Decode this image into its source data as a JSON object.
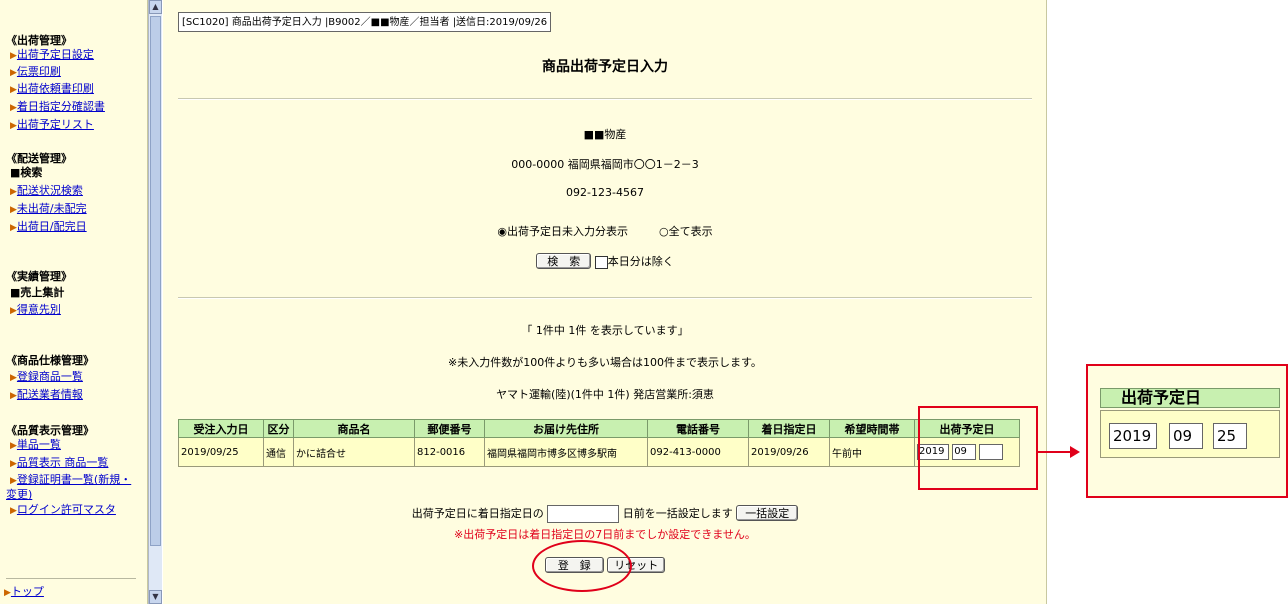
{
  "sidebar": {
    "sections": [
      {
        "title": "《出荷管理》",
        "items": [
          "出荷予定日設定",
          "伝票印刷",
          "出荷依頼書印刷",
          "着日指定分確認書",
          "出荷予定リスト"
        ]
      },
      {
        "title": "《配送管理》",
        "header": "■検索",
        "items": [
          "配送状況検索",
          "未出荷/未配完",
          "出荷日/配完日"
        ]
      },
      {
        "title": "《実績管理》",
        "header": "■売上集計",
        "items": [
          "得意先別"
        ]
      },
      {
        "title": "《商品仕様管理》",
        "items": [
          "登録商品一覧",
          "配送業者情報"
        ]
      },
      {
        "title": "《品質表示管理》",
        "items": [
          "単品一覧",
          "品質表示 商品一覧",
          "登録証明書一覧(新規・変更)",
          "ログイン許可マスタ"
        ]
      }
    ],
    "top_link": "トップ"
  },
  "breadcrumb": "[SC1020] 商品出荷予定日入力 |B9002／■■物産／担当者 |送信日:2019/09/26",
  "page_title": "商品出荷予定日入力",
  "company": {
    "name": "■■物産",
    "address": "000-0000 福岡県福岡市〇〇1－2－3",
    "phone": "092-123-4567"
  },
  "filter": {
    "option_unentered": "出荷予定日未入力分表示",
    "option_all": "全て表示",
    "search_button": "検　索",
    "exclude_today": "本日分は除く"
  },
  "results": {
    "count_text": "「 1件中 1件 を表示しています」",
    "limit_note": "※未入力件数が100件よりも多い場合は100件まで表示します。",
    "carrier_line": "ヤマト運輸(陸)(1件中 1件) 発店営業所:須恵"
  },
  "table": {
    "headers": [
      "受注入力日",
      "区分",
      "商品名",
      "郵便番号",
      "お届け先住所",
      "電話番号",
      "着日指定日",
      "希望時間帯",
      "出荷予定日"
    ],
    "rows": [
      {
        "order_date": "2019/09/25",
        "type": "通信",
        "product": "かに詰合せ",
        "zip": "812-0016",
        "address": "福岡県福岡市博多区博多駅南",
        "phone": "092-413-0000",
        "arrival": "2019/09/26",
        "time": "午前中",
        "ship_year": "2019",
        "ship_month": "09",
        "ship_day": ""
      }
    ]
  },
  "bulk": {
    "prefix": "出荷予定日に着日指定日の",
    "suffix": "日前を一括設定します",
    "button": "一括設定",
    "warning": "※出荷予定日は着日指定日の7日前までしか設定できません。"
  },
  "actions": {
    "register": "登　録",
    "reset": "リセット"
  },
  "zoom": {
    "header": "出荷予定日",
    "year": "2019",
    "month": "09",
    "day": "25"
  },
  "colors": {
    "highlight": "#e0001a",
    "header_green": "#c8f0b0",
    "row_yellow": "#ffffc8",
    "panel_bg": "#fffde0"
  }
}
